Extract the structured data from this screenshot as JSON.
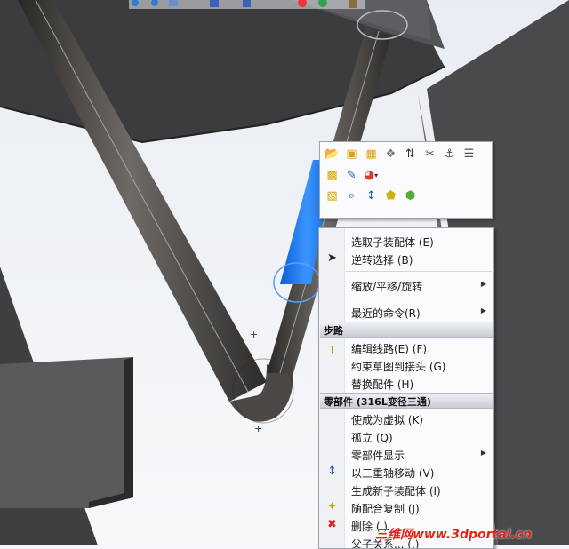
{
  "colors": {
    "menu_bg": "#fbfbfd",
    "section_header_bg": "#d4d7de",
    "selection_blue": "#1e7fff",
    "watermark": "#e2231a"
  },
  "toolbox_icons": [
    [
      "open-folder-icon",
      "part-icon",
      "assembly-icon",
      "components-icon",
      "sort-icon",
      "paperclip-icon",
      "mate-icon",
      "properties-icon"
    ],
    [
      "assembly-folder-icon",
      "edit-icon",
      "appearance-icon"
    ],
    [
      "zoom-to-selection-icon",
      "zoom-icon",
      "normal-to-icon",
      "hide-icon",
      "show-icon"
    ]
  ],
  "context_menu": {
    "select_subassembly": "选取子装配体 (E)",
    "invert_selection": "逆转选择 (B)",
    "zoom_pan_rotate": "缩放/平移/旋转",
    "recent_commands": "最近的命令(R)",
    "routing_header": "步路",
    "edit_route": "编辑线路(E) (F)",
    "constrain_sketch": "约束草图到接头 (G)",
    "replace_fitting": "替换配件 (H)",
    "component_header": "零部件 (316L变径三通)",
    "make_virtual": "使成为虚拟 (K)",
    "isolate": "孤立 (Q)",
    "component_display": "零部件显示",
    "move_triad": "以三重轴移动 (V)",
    "form_subassembly": "生成新子装配体 (I)",
    "copy_with_mates": "随配合复制 (J)",
    "delete": "删除 (.)",
    "parent_child": "父子关系... (.)"
  },
  "watermark": "三维网www.3dportal.cn"
}
